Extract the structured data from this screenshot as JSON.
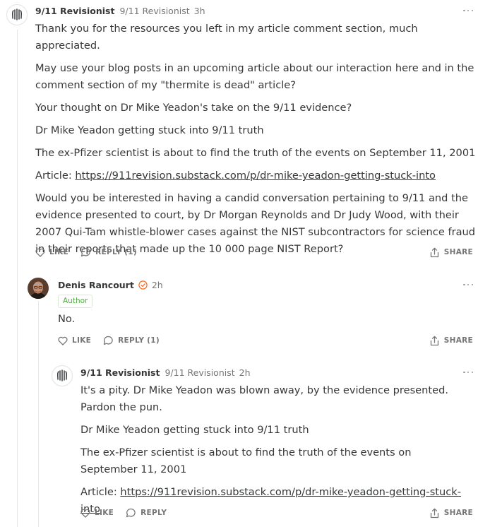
{
  "comments": [
    {
      "author": "9/11 Revisionist",
      "handle": "9/11 Revisionist",
      "time": "3h",
      "paragraphs": [
        "Thank you for the resources you left in my article comment section, much appreciated.",
        "May use your blog posts in an upcoming article about our interaction here and in the comment section of my \"thermite is dead\" article?",
        "Your thought on Dr Mike Yeadon's take on the 9/11 evidence?",
        "Dr Mike Yeadon getting stuck into 9/11 truth",
        "The ex-Pfizer scientist is about to find the truth of the events on September 11, 2001",
        "Would you be interested in having a candid conversation pertaining to 9/11 and the evidence presented to court, by Dr Morgan Reynolds and Dr Judy Wood, with their 2007 Qui-Tam whistle-blower cases against the NIST subcontractors for science fraud in their reports that made up the 10 000 page NIST Report?"
      ],
      "article_prefix": "Article: ",
      "article_link": "https://911revision.substack.com/p/dr-mike-yeadon-getting-stuck-into",
      "like": "LIKE",
      "reply": "REPLY (1)",
      "share": "SHARE"
    },
    {
      "author": "Denis Rancourt",
      "time": "2h",
      "badge": "Author",
      "paragraphs": [
        "No."
      ],
      "like": "LIKE",
      "reply": "REPLY (1)",
      "share": "SHARE"
    },
    {
      "author": "9/11 Revisionist",
      "handle": "9/11 Revisionist",
      "time": "2h",
      "paragraphs": [
        "It's a pity. Dr Mike Yeadon was blown away, by the evidence presented. Pardon the pun.",
        "Dr Mike Yeadon getting stuck into 9/11 truth",
        "The ex-Pfizer scientist is about to find the truth of the events on September 11, 2001"
      ],
      "article_prefix": "Article: ",
      "article_link": "https://911revision.substack.com/p/dr-mike-yeadon-getting-stuck-into",
      "like": "LIKE",
      "reply": "REPLY",
      "share": "SHARE"
    }
  ],
  "colors": {
    "text": "#363737",
    "muted": "#757575",
    "author_badge": "#4caf3d",
    "verified": "#ff6719"
  },
  "icons": [
    "revisionist-logo-icon",
    "more-icon",
    "heart-icon",
    "reply-icon",
    "share-icon",
    "verified-icon"
  ]
}
